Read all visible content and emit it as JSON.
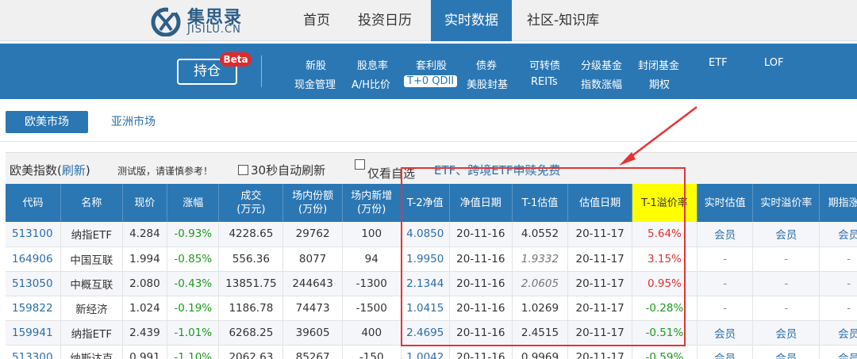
{
  "logo": {
    "cn": "集思录",
    "en": "JISILU.CN"
  },
  "top_nav": [
    {
      "label": "首页",
      "active": false
    },
    {
      "label": "投资日历",
      "active": false
    },
    {
      "label": "实时数据",
      "active": true
    },
    {
      "label": "社区-知识库",
      "active": false
    }
  ],
  "sub_nav": {
    "hold_button": "持仓",
    "beta": "Beta",
    "row1": [
      "新股",
      "股息率",
      "套利股",
      "债券",
      "可转债",
      "分级基金",
      "封闭基金",
      "ETF",
      "LOF"
    ],
    "row2": [
      "现金管理",
      "A/H比价",
      "T+0 QDII",
      "美股封基",
      "REITs",
      "指数涨幅",
      "期权"
    ]
  },
  "market_tabs": {
    "active": "欧美市场",
    "other": "亚洲市场"
  },
  "toolbar": {
    "title": "欧美指数(",
    "refresh": "刷新",
    "close_paren": ")",
    "note": "测试版，请谨慎参考！",
    "auto_refresh": "30秒自动刷新",
    "watch_only": "仅看自选",
    "promo": "ETF、跨境ETF申赎免费"
  },
  "table": {
    "headers": [
      "代码",
      "名称",
      "现价",
      "涨幅",
      "成交\n(万元)",
      "场内份额\n(万份)",
      "场内新增\n(万份)",
      "T-2净值",
      "净值日期",
      "T-1估值",
      "估值日期",
      "T-1溢价率",
      "实时估值",
      "实时溢价率",
      "期指涨幅"
    ],
    "rows": [
      [
        "513100",
        "纳指ETF",
        "4.284",
        "-0.93%",
        "4228.65",
        "29762",
        "100",
        "4.0850",
        "20-11-16",
        "4.0552",
        "20-11-17",
        "5.64%",
        "会员",
        "会员",
        "会员"
      ],
      [
        "164906",
        "中国互联",
        "1.994",
        "-0.85%",
        "556.36",
        "8077",
        "94",
        "1.9950",
        "20-11-16",
        "1.9332",
        "20-11-17",
        "3.15%",
        "-",
        "-",
        "-"
      ],
      [
        "513050",
        "中概互联",
        "2.080",
        "-0.43%",
        "13851.75",
        "244643",
        "-1300",
        "2.1344",
        "20-11-16",
        "2.0605",
        "20-11-17",
        "0.95%",
        "-",
        "-",
        "-"
      ],
      [
        "159822",
        "新经济",
        "1.024",
        "-0.19%",
        "1186.78",
        "74473",
        "-1500",
        "1.0415",
        "20-11-16",
        "1.0269",
        "20-11-17",
        "-0.28%",
        "-",
        "-",
        "-"
      ],
      [
        "159941",
        "纳指ETF",
        "2.439",
        "-1.01%",
        "6268.25",
        "39605",
        "400",
        "2.4695",
        "20-11-16",
        "2.4515",
        "20-11-17",
        "-0.51%",
        "会员",
        "会员",
        "会员"
      ],
      [
        "513300",
        "纳斯达克",
        "0.991",
        "-1.10%",
        "2062.63",
        "85267",
        "-150",
        "1.0042",
        "20-11-16",
        "0.9969",
        "20-11-17",
        "-0.59%",
        "会员",
        "会员",
        "会员"
      ]
    ],
    "estimate_italic": [
      false,
      true,
      true,
      false,
      false,
      false
    ]
  },
  "colors": {
    "brand": "#2b77b4",
    "highlight": "#ffff00",
    "up": "#e03030",
    "down": "#1d9a1d",
    "annotation": "#e53333"
  }
}
